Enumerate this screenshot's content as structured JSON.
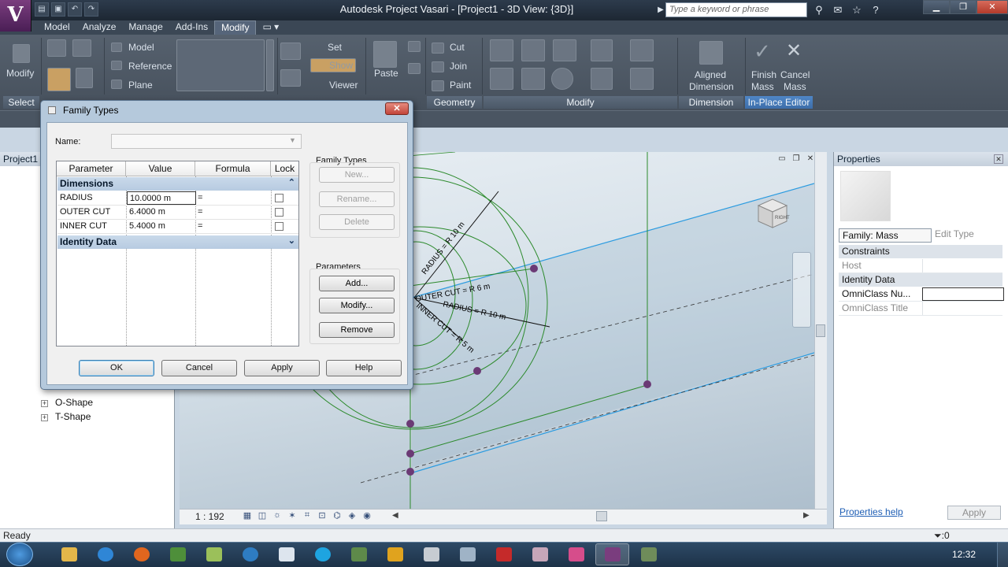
{
  "app": {
    "logo": "V",
    "window_title": "Autodesk Project Vasari - [Project1 - 3D View: {3D}]",
    "search_placeholder": "Type a keyword or phrase"
  },
  "ribbon": {
    "tabs": [
      {
        "label": "Model"
      },
      {
        "label": "Analyze"
      },
      {
        "label": "Manage"
      },
      {
        "label": "Add-Ins"
      },
      {
        "label": "Modify",
        "active": true
      }
    ],
    "modify": {
      "label": "Modify"
    },
    "draw": {
      "model": "Model",
      "reference": "Reference",
      "plane": "Plane"
    },
    "workplane": {
      "set": "Set",
      "show": "Show",
      "viewer": "Viewer"
    },
    "clipboard": {
      "paste": "Paste"
    },
    "geometry": {
      "cut": "Cut",
      "join": "Join",
      "paint": "Paint"
    },
    "dimension": {
      "aligned": "Aligned",
      "dimension": "Dimension"
    },
    "inplace": {
      "finish": "Finish",
      "cancel": "Cancel",
      "mass": "Mass"
    },
    "panels": {
      "select": "Select",
      "geometry": "Geometry",
      "modify": "Modify",
      "dimension": "Dimension",
      "inplace_editor": "In-Place Editor"
    }
  },
  "project_browser": {
    "title": "Project1",
    "items": [
      "O-Shape",
      "T-Shape"
    ]
  },
  "viewport": {
    "labels": [
      "RADIUS = R 10 m",
      "OUTER CUT = R 6 m",
      "RADIUS = R 10 m",
      "INNER CUT = R 5 m"
    ],
    "viewcube_face": "RIGHT"
  },
  "viewbar": {
    "scale": "1 : 192"
  },
  "properties": {
    "title": "Properties",
    "family_select": "Family: Mass",
    "edit_type": "Edit Type",
    "groups": [
      {
        "label": "Constraints",
        "rows": [
          {
            "key": "Host",
            "value": ""
          }
        ]
      },
      {
        "label": "Identity Data",
        "rows": [
          {
            "key": "OmniClass Nu...",
            "value": ""
          },
          {
            "key": "OmniClass Title",
            "value": ""
          }
        ]
      }
    ],
    "help_link": "Properties help",
    "apply": "Apply"
  },
  "status": {
    "text": "Ready",
    "filter": ":0"
  },
  "taskbar": {
    "clock": "12:32"
  },
  "dialog": {
    "title": "Family Types",
    "name_label": "Name:",
    "name_value": "",
    "table": {
      "headers": [
        "Parameter",
        "Value",
        "Formula",
        "Lock"
      ],
      "groups": [
        {
          "label": "Dimensions",
          "rows": [
            {
              "name": "RADIUS",
              "value": "10.0000 m",
              "formula": "="
            },
            {
              "name": "OUTER CUT",
              "value": "6.4000 m",
              "formula": "="
            },
            {
              "name": "INNER CUT",
              "value": "5.4000 m",
              "formula": "="
            }
          ]
        },
        {
          "label": "Identity Data",
          "rows": []
        }
      ]
    },
    "family_types": {
      "label": "Family Types",
      "new": "New...",
      "rename": "Rename...",
      "delete": "Delete"
    },
    "parameters": {
      "label": "Parameters",
      "add": "Add...",
      "modify": "Modify...",
      "remove": "Remove"
    },
    "buttons": {
      "ok": "OK",
      "cancel": "Cancel",
      "apply": "Apply",
      "help": "Help"
    }
  },
  "colors": {
    "accent": "#3d6ea9",
    "geometry": "#2c8a2c",
    "reference": "#2b9be0",
    "point": "#6b3a75"
  }
}
